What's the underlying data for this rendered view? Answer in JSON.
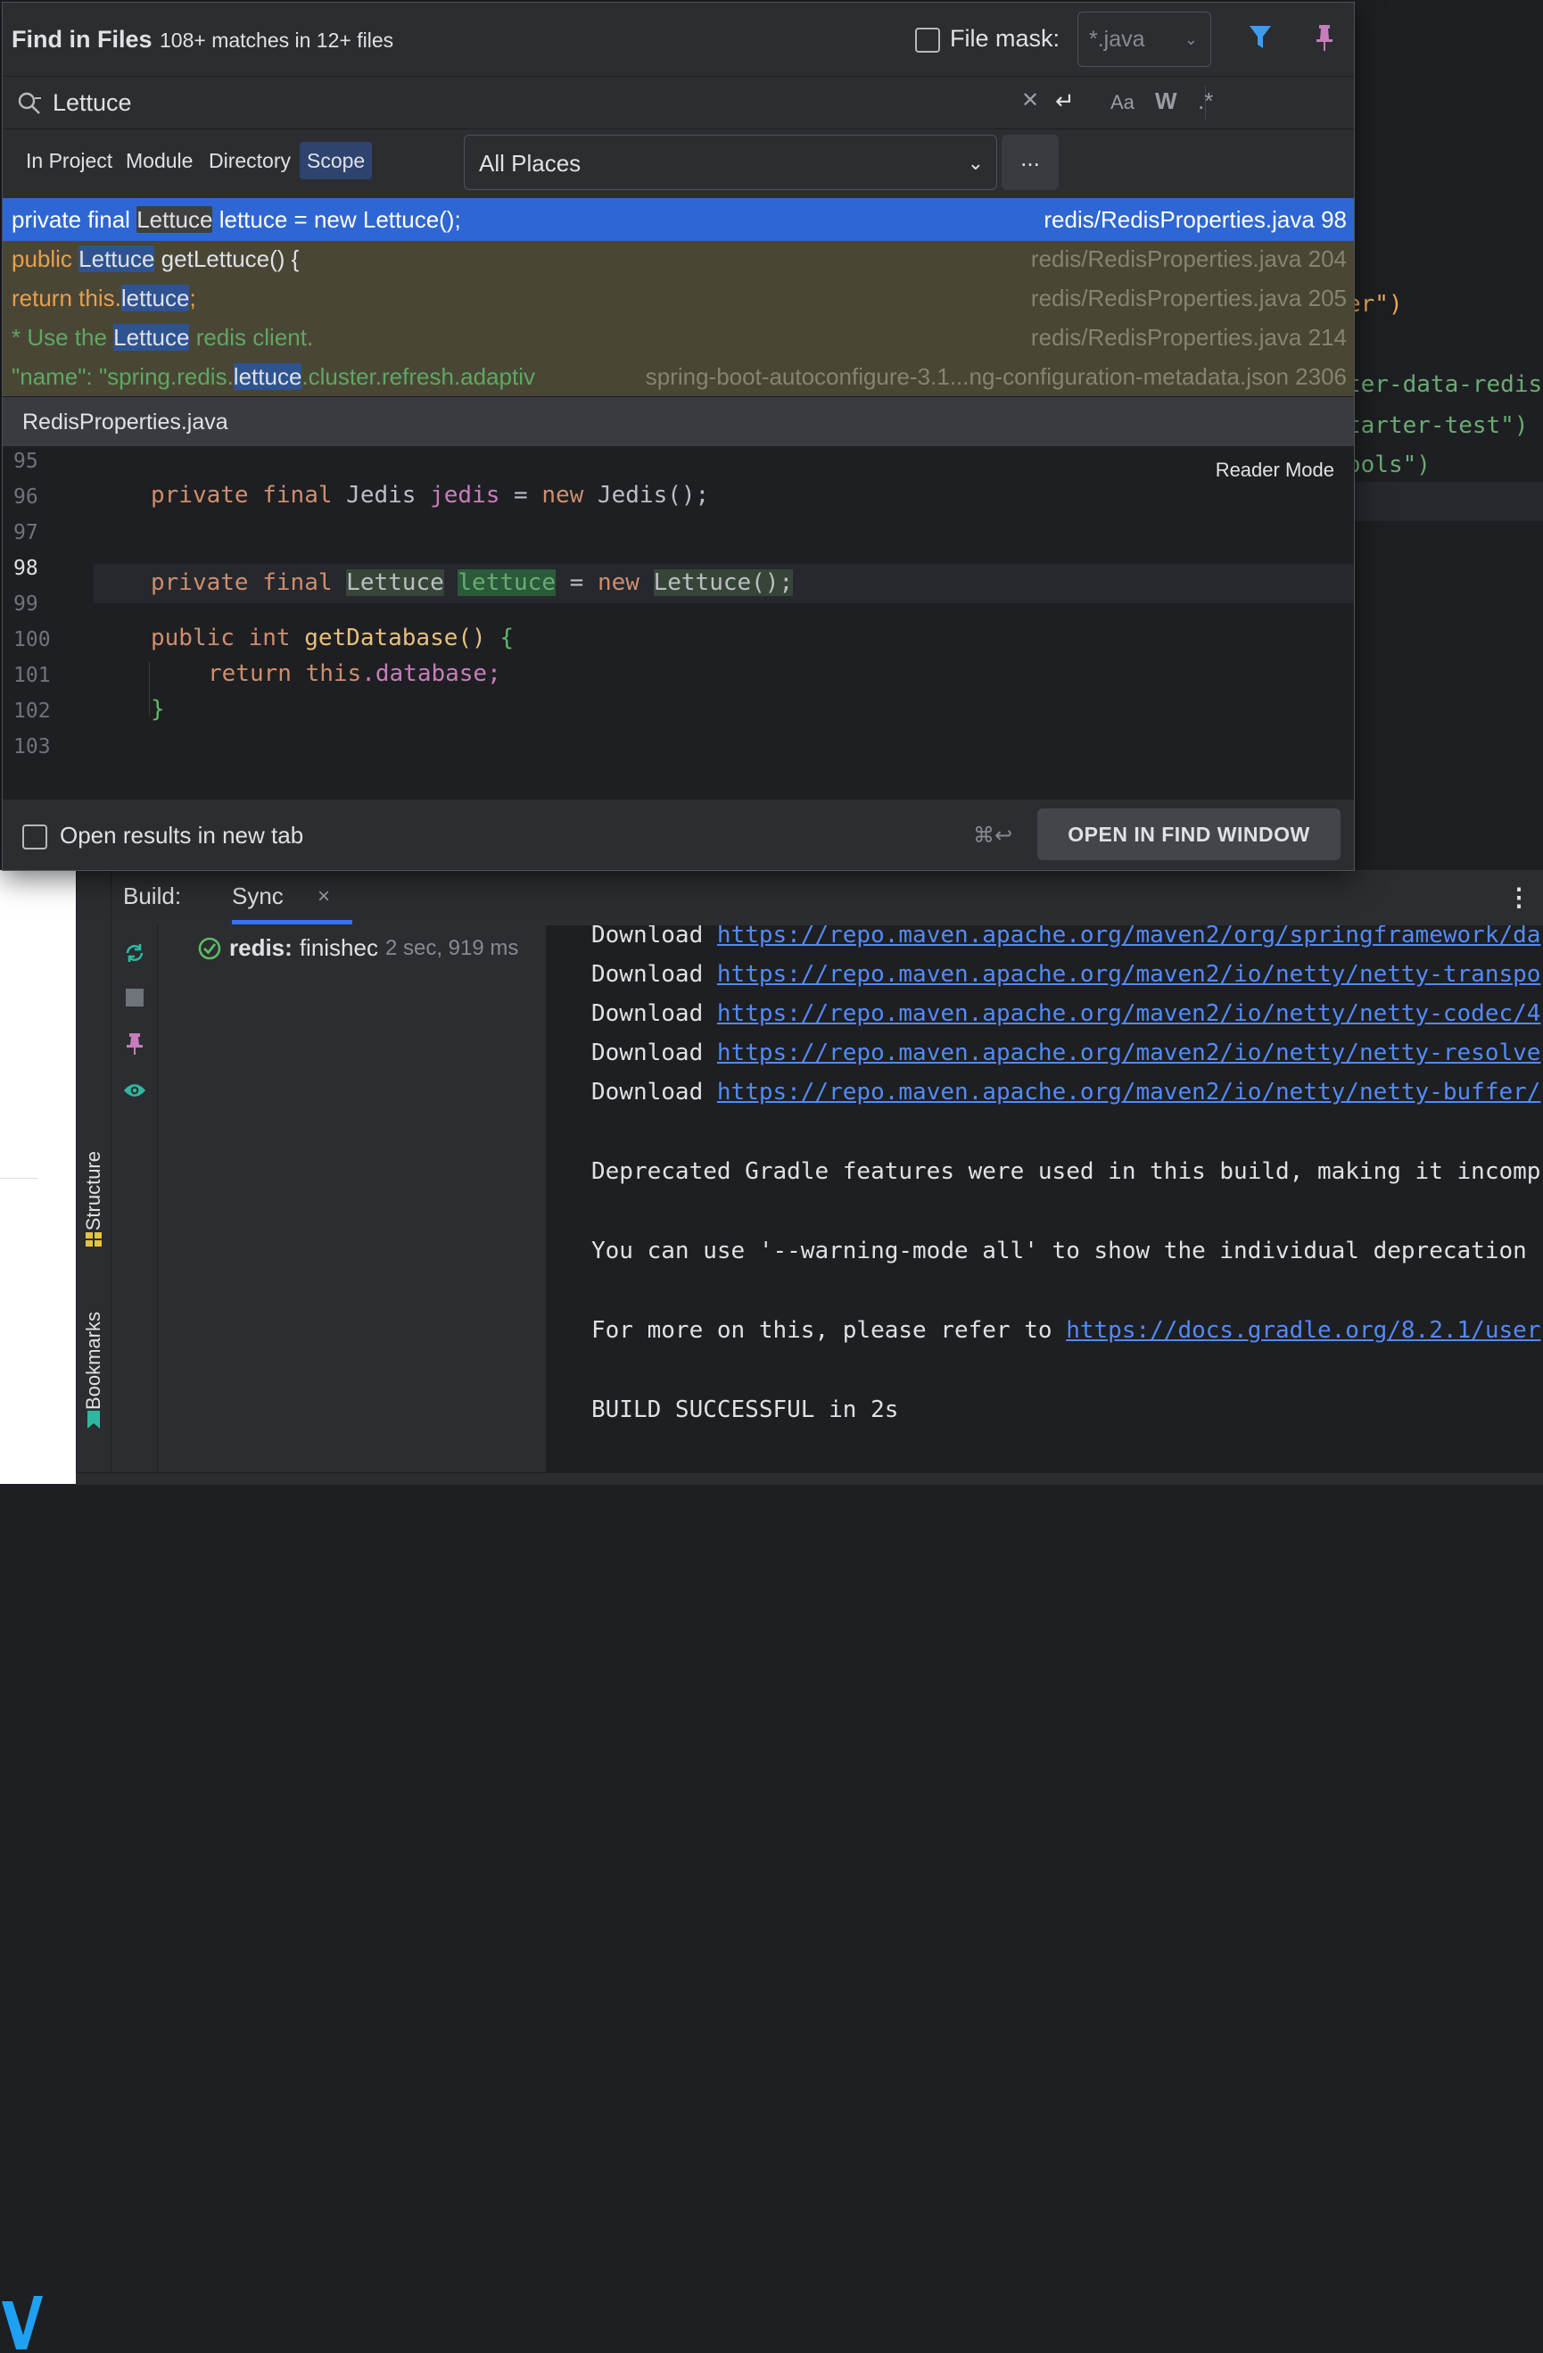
{
  "find": {
    "title": "Find in Files",
    "matches": "108+ matches in 12+ files",
    "file_mask_label": "File mask:",
    "file_mask_value": "*.java",
    "query": "Lettuce",
    "opt_case": "Aa",
    "opt_words": "W",
    "opt_regex": ".*",
    "scope_tabs": [
      "In Project",
      "Module",
      "Directory",
      "Scope"
    ],
    "scope_active": "Scope",
    "scope_value": "All Places",
    "more": "...",
    "results": [
      {
        "pre": "private final ",
        "hl": "Lettuce",
        "post": " lettuce = new Lettuce();",
        "file": "redis/RedisProperties.java 98"
      },
      {
        "pre": "public ",
        "hl": "Lettuce",
        "post": " getLettuce() {",
        "file": "redis/RedisProperties.java 204"
      },
      {
        "pre": "return this.",
        "hl": "lettuce",
        "post": ";",
        "file": "redis/RedisProperties.java 205"
      },
      {
        "pre": "* Use the ",
        "hl": "Lettuce",
        "post": " redis client.",
        "file": "redis/RedisProperties.java 214"
      },
      {
        "pre": "\"name\": \"spring.redis.",
        "hl": "lettuce",
        "post": ".cluster.refresh.adaptiv",
        "file": "spring-boot-autoconfigure-3.1...ng-configuration-metadata.json 2306"
      }
    ],
    "preview_file": "RedisProperties.java",
    "reader_mode": "Reader Mode",
    "line_numbers": [
      "95",
      "96",
      "97",
      "98",
      "99",
      "100",
      "101",
      "102",
      "103"
    ],
    "code": {
      "l96": [
        "private",
        "final",
        "Jedis",
        "jedis",
        "=",
        "new",
        "Jedis();"
      ],
      "l98": [
        "private",
        "final",
        "Lettuce",
        "lettuce",
        "=",
        "new",
        "Lettuce();"
      ],
      "l100": [
        "public",
        "int",
        "getDatabase()",
        "{"
      ],
      "l101": [
        "return",
        "this",
        ".database;"
      ],
      "l102": "}"
    },
    "open_new_tab": "Open results in new tab",
    "shortcut": "⌘↩",
    "open_button": "OPEN IN FIND WINDOW"
  },
  "background": {
    "lines": [
      "er\")",
      "ter-data-redis",
      "tarter-test\")",
      "ools\")"
    ]
  },
  "build": {
    "title": "Build:",
    "tab": "Sync",
    "tab_close": "×",
    "tree_project": "redis:",
    "tree_status": "finishec",
    "tree_time": "2 sec, 919 ms",
    "downloads": [
      {
        "label": "Download",
        "url": "https://repo.maven.apache.org/maven2/org/springframework/da"
      },
      {
        "label": "Download",
        "url": "https://repo.maven.apache.org/maven2/io/netty/netty-transpo"
      },
      {
        "label": "Download",
        "url": "https://repo.maven.apache.org/maven2/io/netty/netty-codec/4"
      },
      {
        "label": "Download",
        "url": "https://repo.maven.apache.org/maven2/io/netty/netty-resolve"
      },
      {
        "label": "Download",
        "url": "https://repo.maven.apache.org/maven2/io/netty/netty-buffer/"
      }
    ],
    "deprecated": "Deprecated Gradle features were used in this build, making it incomp",
    "warning_mode": "You can use '--warning-mode all' to show the individual deprecation",
    "more_info_prefix": "For more on this, please refer to ",
    "more_info_url": "https://docs.gradle.org/8.2.1/user",
    "result": "BUILD SUCCESSFUL in 2s"
  },
  "sidebar": {
    "structure": "Structure",
    "bookmarks": "Bookmarks"
  },
  "colors": {
    "accent": "#2e67d3",
    "link": "#548af7",
    "success": "#5fb865",
    "pin": "#c77dbb"
  }
}
